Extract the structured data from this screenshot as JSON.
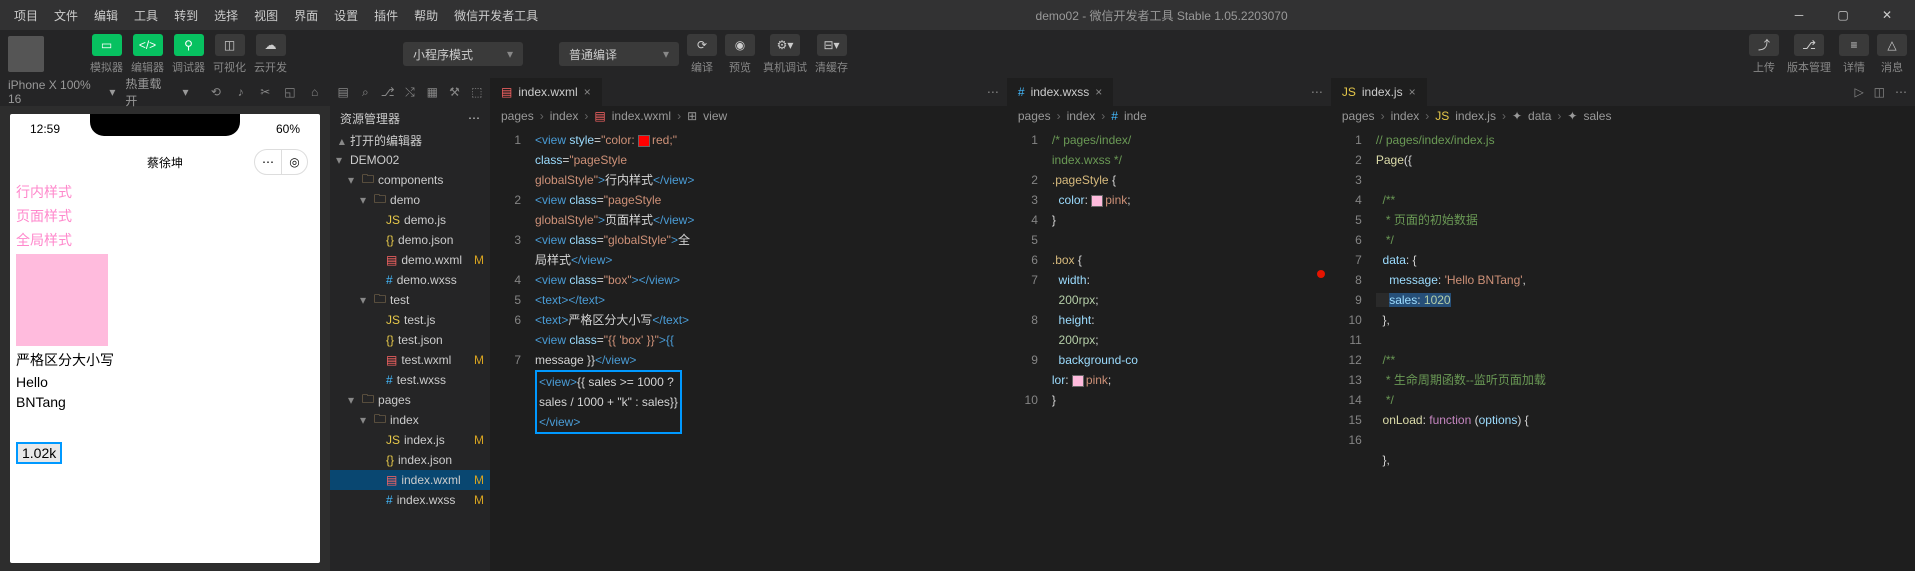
{
  "app": {
    "title": "demo02 - 微信开发者工具 Stable 1.05.2203070",
    "menus": [
      "项目",
      "文件",
      "编辑",
      "工具",
      "转到",
      "选择",
      "视图",
      "界面",
      "设置",
      "插件",
      "帮助",
      "微信开发者工具"
    ]
  },
  "toolbar": {
    "labels": {
      "simulator": "模拟器",
      "editor": "编辑器",
      "debugger": "调试器",
      "visualizer": "可视化",
      "cloud": "云开发",
      "compile": "编译",
      "preview": "预览",
      "remote": "真机调试",
      "cache": "清缓存",
      "upload": "上传",
      "version": "版本管理",
      "details": "详情",
      "notify": "消息"
    },
    "mode": "小程序模式",
    "compile_mode": "普通编译"
  },
  "simulator": {
    "device": "iPhone X 100% 16",
    "hotreload": "热重载 开",
    "time": "12:59",
    "battery": "60%",
    "nav_title": "蔡徐坤",
    "lines": {
      "inline": "行内样式",
      "page": "页面样式",
      "global": "全局样式",
      "strict": "严格区分大小写",
      "hello": "Hello",
      "bntang": "BNTang"
    },
    "sales_display": "1.02k"
  },
  "explorer": {
    "header": "资源管理器",
    "open_editors": "打开的编辑器",
    "project": "DEMO02",
    "tree": [
      {
        "type": "folder",
        "name": "components",
        "indent": 1,
        "open": true
      },
      {
        "type": "folder",
        "name": "demo",
        "indent": 2,
        "open": true
      },
      {
        "type": "file",
        "name": "demo.js",
        "indent": 3,
        "icon": "js"
      },
      {
        "type": "file",
        "name": "demo.json",
        "indent": 3,
        "icon": "json"
      },
      {
        "type": "file",
        "name": "demo.wxml",
        "indent": 3,
        "icon": "wxml",
        "mod": "M"
      },
      {
        "type": "file",
        "name": "demo.wxss",
        "indent": 3,
        "icon": "wxss"
      },
      {
        "type": "folder",
        "name": "test",
        "indent": 2,
        "open": true
      },
      {
        "type": "file",
        "name": "test.js",
        "indent": 3,
        "icon": "js"
      },
      {
        "type": "file",
        "name": "test.json",
        "indent": 3,
        "icon": "json"
      },
      {
        "type": "file",
        "name": "test.wxml",
        "indent": 3,
        "icon": "wxml",
        "mod": "M"
      },
      {
        "type": "file",
        "name": "test.wxss",
        "indent": 3,
        "icon": "wxss"
      },
      {
        "type": "folder",
        "name": "pages",
        "indent": 1,
        "open": true
      },
      {
        "type": "folder",
        "name": "index",
        "indent": 2,
        "open": true
      },
      {
        "type": "file",
        "name": "index.js",
        "indent": 3,
        "icon": "js",
        "mod": "M"
      },
      {
        "type": "file",
        "name": "index.json",
        "indent": 3,
        "icon": "json"
      },
      {
        "type": "file",
        "name": "index.wxml",
        "indent": 3,
        "icon": "wxml",
        "mod": "M",
        "active": true
      },
      {
        "type": "file",
        "name": "index.wxss",
        "indent": 3,
        "icon": "wxss",
        "mod": "M"
      }
    ]
  },
  "editor1": {
    "tab": "index.wxml",
    "crumbs": [
      "pages",
      "index",
      "index.wxml",
      "view"
    ],
    "gutter": [
      "1",
      "",
      "",
      "2",
      "",
      "3",
      "",
      "4",
      "5",
      "6",
      "",
      "7",
      "",
      ""
    ]
  },
  "editor2": {
    "tab": "index.wxss",
    "crumbs": [
      "pages",
      "index",
      "inde"
    ],
    "gutter": [
      "1",
      "",
      "2",
      "3",
      "4",
      "5",
      "6",
      "7",
      "",
      "8",
      "",
      "9",
      "",
      "10"
    ]
  },
  "editor3": {
    "tab": "index.js",
    "crumbs": [
      "pages",
      "index",
      "index.js",
      "data",
      "sales"
    ],
    "gutter": [
      "1",
      "2",
      "3",
      "4",
      "5",
      "6",
      "7",
      "8",
      "9",
      "10",
      "11",
      "12",
      "13",
      "14",
      "15",
      "16"
    ]
  },
  "code1": {
    "l1a": "<view",
    "l1b": "style",
    "l1c": "\"color:",
    "l1d": "red;\"",
    "l1e": "class",
    "l1f": "\"pageStyle",
    "l1g": "globalStyle\"",
    "l1h": "行内样式",
    "l1i": "</view>",
    "l2a": "<view",
    "l2b": "class",
    "l2c": "\"pageStyle",
    "l2d": "globalStyle\"",
    "l2e": "页面样式",
    "l2f": "</view>",
    "l3a": "<view",
    "l3b": "class",
    "l3c": "\"globalStyle\"",
    "l3d": "全",
    "l3e": "局样式",
    "l3f": "</view>",
    "l4a": "<view",
    "l4b": "class",
    "l4c": "\"box\"",
    "l4d": "></view>",
    "l5a": "<text></text>",
    "l6a": "<text>",
    "l6b": "严格区分大小写",
    "l6c": "</text>",
    "l7a": "<view",
    "l7b": "class",
    "l7c": "\"{{ 'box' }}\"",
    "l7d": ">{{",
    "l7e": "message }}",
    "l7f": "</view>",
    "l8a": "<view>",
    "l8b": "{{ sales >= 1000 ?",
    "l8c": "sales / 1000 + \"k\" : sales}}",
    "l8d": "</view>"
  },
  "code2": {
    "l1": "/* pages/index/",
    "l1b": "index.wxss */",
    "l2": ".pageStyle",
    "l2b": "{",
    "l3": "color",
    "l3b": "pink",
    "l3c": ";",
    "l4": "}",
    "l6": ".box",
    "l6b": "{",
    "l7": "width",
    "l7b": ":",
    "l8": "200rpx",
    "l8b": ";",
    "l9": "height",
    "l9b": ":",
    "l10": "200rpx",
    "l10b": ";",
    "l11": "background-co",
    "l12": "lor",
    "l12b": "pink",
    "l12c": ";",
    "l14": "}"
  },
  "code3": {
    "l1": "// pages/index/index.js",
    "l2": "Page",
    "l2b": "({",
    "l4": "/**",
    "l5": " * 页面的初始数据",
    "l6": " */",
    "l7": "data",
    "l7b": ": {",
    "l8": "message",
    "l8b": ": ",
    "l8c": "'Hello BNTang'",
    "l8d": ",",
    "l9": "sales",
    "l9b": ": ",
    "l9c": "1020",
    "l10": "},",
    "l12": "/**",
    "l13": " * 生命周期函数--监听页面加载",
    "l14": " */",
    "l15": "onLoad",
    "l15b": ": ",
    "l15c": "function",
    "l15d": " (",
    "l15e": "options",
    "l15f": ") {",
    "l16": "},"
  }
}
